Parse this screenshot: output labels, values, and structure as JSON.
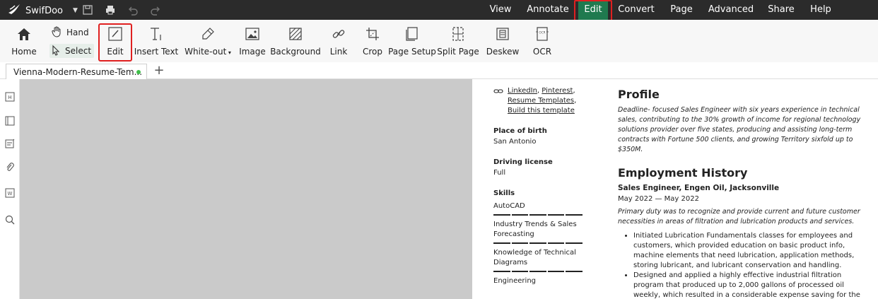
{
  "app": {
    "name": "SwifDoo"
  },
  "menu": [
    "View",
    "Annotate",
    "Edit",
    "Convert",
    "Page",
    "Advanced",
    "Share",
    "Help"
  ],
  "toolbar": {
    "home": "Home",
    "hand": "Hand",
    "select": "Select",
    "edit": "Edit",
    "insert_text": "Insert Text",
    "white_out": "White-out",
    "image": "Image",
    "background": "Background",
    "link": "Link",
    "crop": "Crop",
    "page_setup": "Page Setup",
    "split_page": "Split Page",
    "deskew": "Deskew",
    "ocr": "OCR"
  },
  "tab": {
    "title": "Vienna-Modern-Resume-Tem..."
  },
  "colors": {
    "accent": "#1f7a4f",
    "highlight": "#e02020"
  },
  "document": {
    "links": [
      "LinkedIn",
      "Pinterest",
      "Resume Templates",
      "Build this template"
    ],
    "place_of_birth_label": "Place of birth",
    "place_of_birth": "San Antonio",
    "driving_label": "Driving license",
    "driving": "Full",
    "skills_label": "Skills",
    "skills": [
      {
        "line1": "AutoCAD",
        "line2": ""
      },
      {
        "line1": "Industry Trends & Sales",
        "line2": "Forecasting"
      },
      {
        "line1": "Knowledge of Technical",
        "line2": "Diagrams"
      },
      {
        "line1": "Engineering",
        "line2": ""
      }
    ],
    "profile_title": "Profile",
    "profile_text": "Deadline- focused Sales Engineer with six years experience in technical sales, contributing to the 30% growth of income for regional technology solutions provider over five states, producing and assisting long-term contracts with Fortune 500 clients, and growing Territory sixfold up to $350M.",
    "employment_title": "Employment History",
    "job_title": "Sales Engineer, Engen Oil, Jacksonville",
    "job_date": "May 2022 — May 2022",
    "job_summary": "Primary duty was to recognize and provide current and future customer necessities in areas of filtration and lubrication products and services.",
    "bullets": [
      "Initiated Lubrication Fundamentals classes for employees and customers, which provided education on basic product info, machine elements that need lubrication, application methods, storing lubricant, and lubricant conservation and handling.",
      "Designed and applied a highly effective industrial filtration program that produced up to 2,000 gallons of processed oil weekly, which resulted in a considerable expense saving for the customer and improved profits for the company."
    ]
  }
}
